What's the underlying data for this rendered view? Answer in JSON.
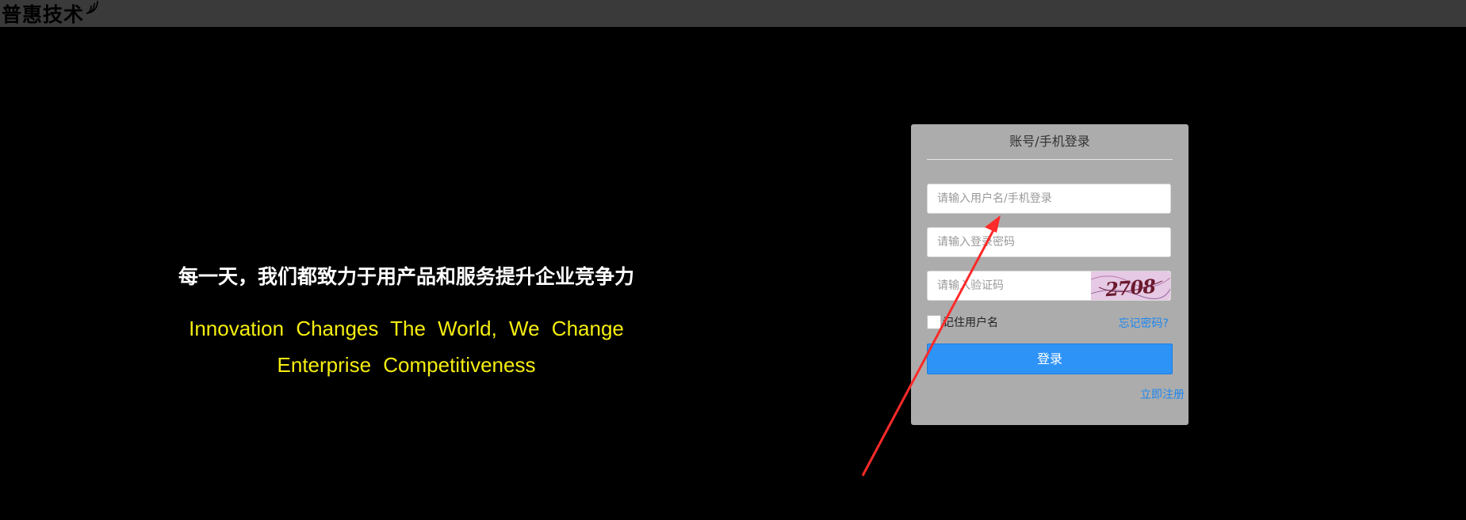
{
  "header": {
    "logo_text": "普惠技术",
    "logo_icon": "signal-wave-icon"
  },
  "hero": {
    "slogan_cn": "每一天，我们都致力于用产品和服务提升企业竞争力",
    "slogan_en_line1": "Innovation Changes The World, We Change",
    "slogan_en_line2": "Enterprise Competitiveness"
  },
  "login": {
    "title": "账号/手机登录",
    "username_placeholder": "请输入用户名/手机登录",
    "password_placeholder": "请输入登录密码",
    "captcha_placeholder": "请输入验证码",
    "captcha_text": "2708",
    "remember_label": "记住用户名",
    "forgot_label": "忘记密码?",
    "login_button": "登录",
    "register_link": "立即注册"
  },
  "colors": {
    "accent": "#2e93f7",
    "link": "#1e87f0",
    "slogan_en": "#f5ee0f",
    "annotation_arrow": "#ff2a2a"
  }
}
